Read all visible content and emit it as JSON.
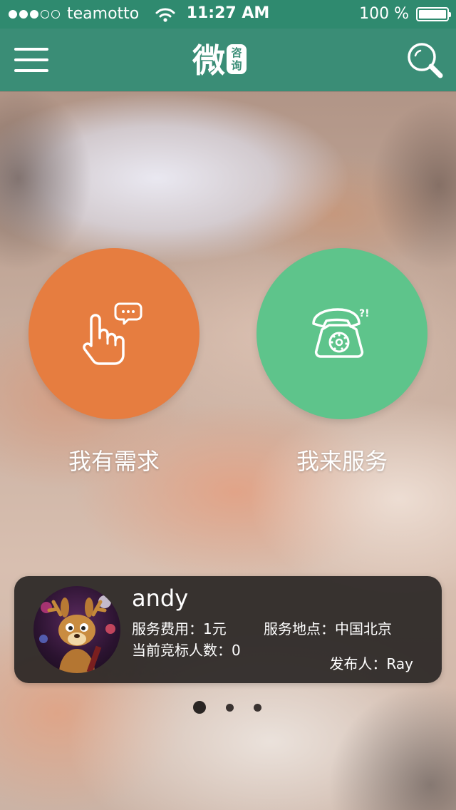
{
  "status_bar": {
    "carrier": "teamotto",
    "time": "11:27 AM",
    "battery": "100 %",
    "signal_dots_filled": 3,
    "signal_dots_total": 5
  },
  "nav": {
    "logo_main": "微",
    "logo_badge_top": "咨",
    "logo_badge_bottom": "询",
    "menu_icon": "hamburger-menu-icon",
    "search_icon": "search-icon"
  },
  "actions": {
    "need_label": "我有需求",
    "serve_label": "我来服务",
    "need_icon": "hand-pointer-chat-icon",
    "serve_icon": "telephone-icon",
    "need_color": "#e67d40",
    "serve_color": "#5ec48b"
  },
  "card": {
    "name": "andy",
    "fee": "服务费用：1元",
    "location": "服务地点：中国北京",
    "bidders": "当前竞标人数：0",
    "publisher": "发布人：Ray"
  },
  "pager": {
    "pages": 3,
    "active": 1
  },
  "colors": {
    "header": "#3a8d76",
    "status_bar": "#2f8a6f",
    "card_bg": "#262221"
  }
}
